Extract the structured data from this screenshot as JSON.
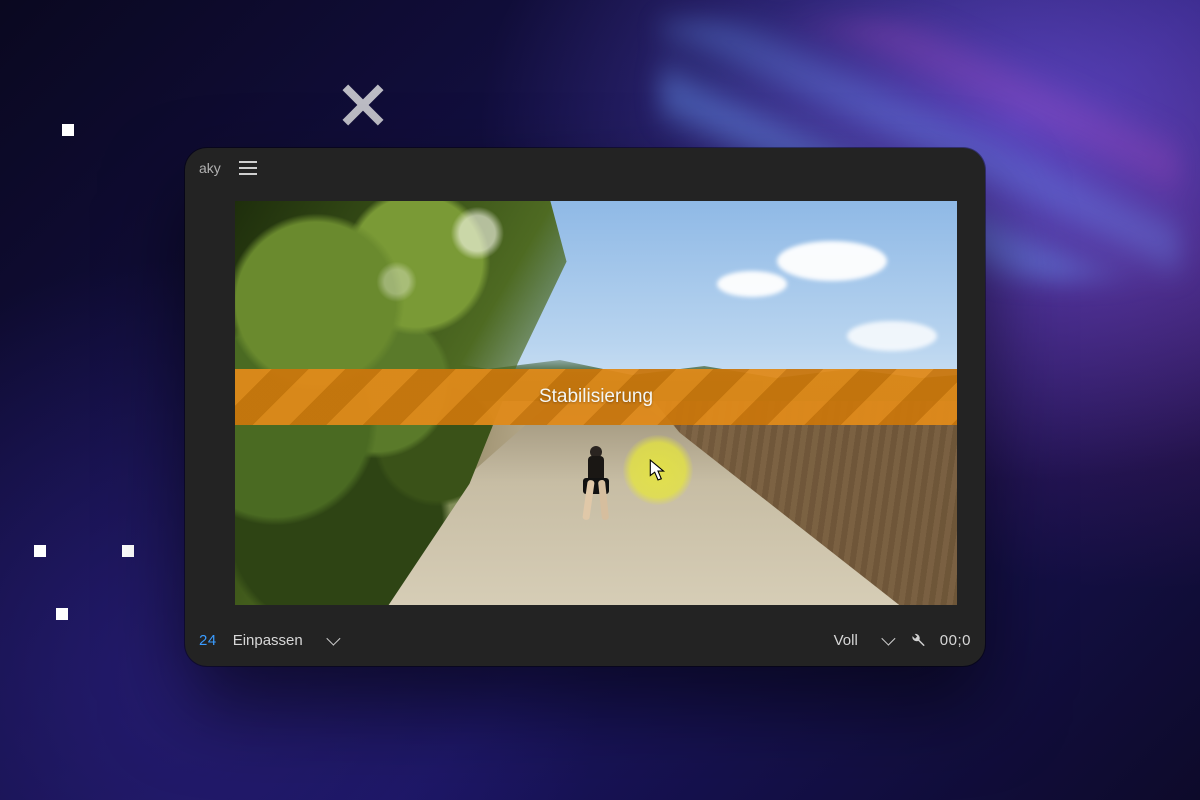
{
  "titlebar": {
    "project_fragment": "aky"
  },
  "preview": {
    "banner_label": "Stabilisierung"
  },
  "bottombar": {
    "timecode_left_fragment": "24",
    "zoom_dropdown": {
      "selected": "Einpassen"
    },
    "quality_dropdown": {
      "selected": "Voll"
    },
    "timecode_right_fragment": "00;0"
  }
}
